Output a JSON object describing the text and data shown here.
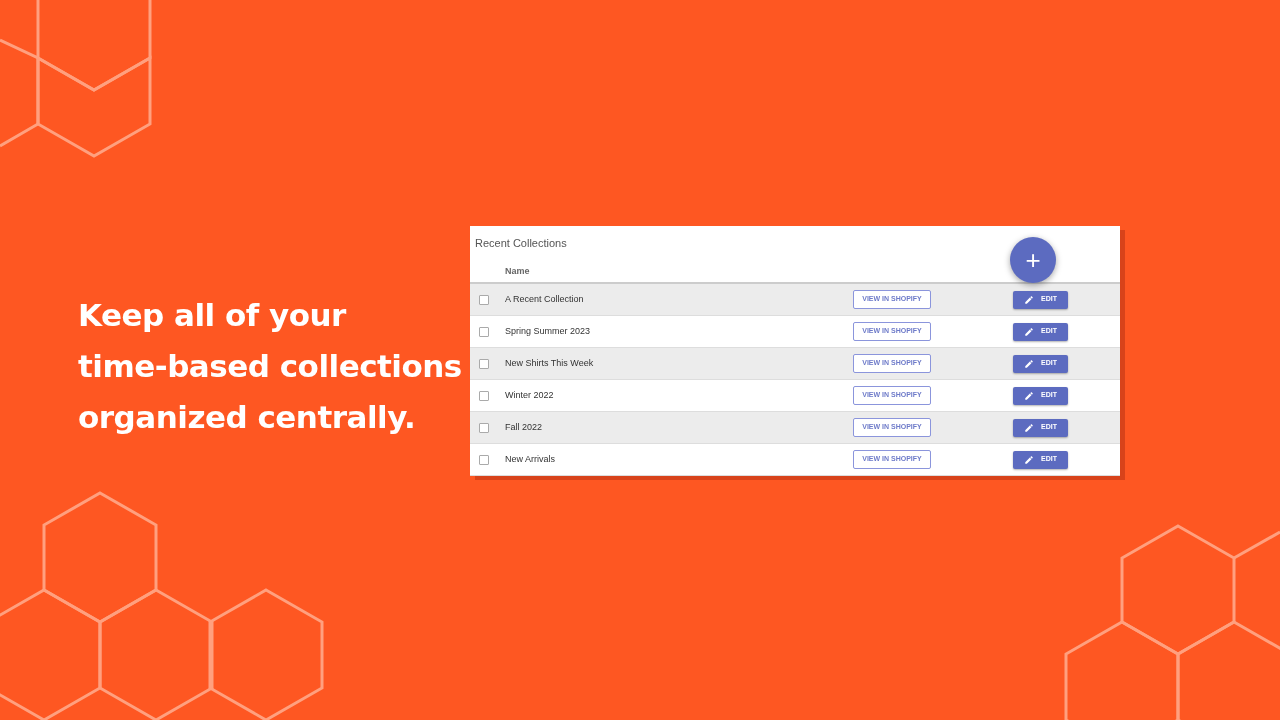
{
  "headline": "Keep all of your\ntime-based collections\norganized centrally.",
  "card": {
    "title": "Recent Collections",
    "add_button": "+",
    "columns": [
      "Name"
    ],
    "rows": [
      {
        "name": "A Recent Collection",
        "checked": false,
        "view_button": "VIEW IN SHOPIFY",
        "edit_button": "EDIT"
      },
      {
        "name": "Spring Summer 2023",
        "checked": false,
        "view_button": "VIEW IN SHOPIFY",
        "edit_button": "EDIT"
      },
      {
        "name": "New Shirts This Week",
        "checked": false,
        "view_button": "VIEW IN SHOPIFY",
        "edit_button": "EDIT"
      },
      {
        "name": "Winter 2022",
        "checked": false,
        "view_button": "VIEW IN SHOPIFY",
        "edit_button": "EDIT"
      },
      {
        "name": "Fall 2022",
        "checked": false,
        "view_button": "VIEW IN SHOPIFY",
        "edit_button": "EDIT"
      },
      {
        "name": "New Arrivals",
        "checked": false,
        "view_button": "VIEW IN SHOPIFY",
        "edit_button": "EDIT"
      }
    ]
  }
}
